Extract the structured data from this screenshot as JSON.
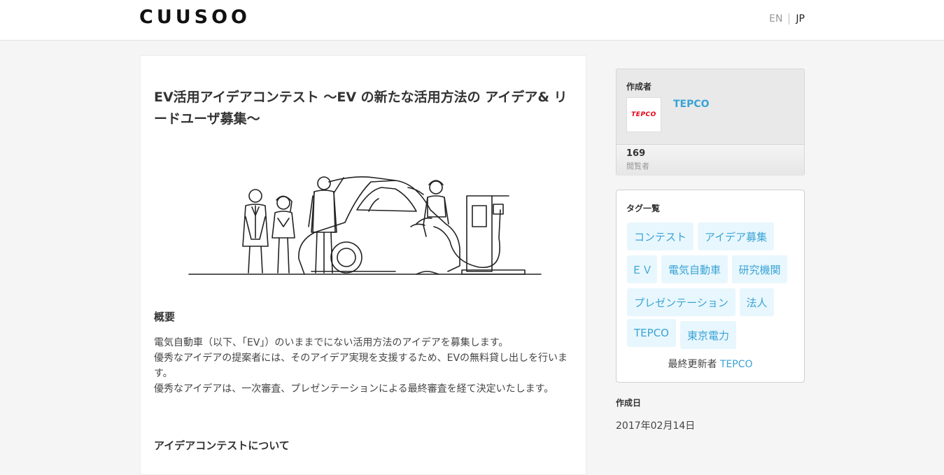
{
  "header": {
    "logo": "CUUSOO",
    "lang_en": "EN",
    "lang_jp": "JP"
  },
  "article": {
    "title": "EV活用アイデアコンテスト ～EV の新たな活用方法の アイデア& リードユーザ募集～",
    "overview_heading": "概要",
    "overview_lines": [
      "電気自動車（以下、「EV」）のいままでにない活用方法のアイデアを募集します。",
      "優秀なアイデアの提案者には、そのアイデア実現を支援するため、EVの無料貸し出しを行います。",
      "優秀なアイデアは、一次審査、プレゼンテーションによる最終審査を経て決定いたします。"
    ],
    "contest_heading": "アイデアコンテストについて"
  },
  "author": {
    "label": "作成者",
    "logo_text": "TEPCO",
    "name": "TEPCO",
    "views_count": "169",
    "views_label": "閲覧者"
  },
  "tags": {
    "label": "タグ一覧",
    "items": [
      "コンテスト",
      "アイデア募集",
      "ＥＶ",
      "電気自動車",
      "研究機関",
      "プレゼンテーション",
      "法人",
      "TEPCO",
      "東京電力"
    ],
    "updated_label": "最終更新者",
    "updated_by": "TEPCO"
  },
  "created": {
    "label": "作成日",
    "date": "2017年02月14日"
  },
  "colors": {
    "link": "#3aa3d6",
    "tag_bg": "#e8f7fd",
    "brand_red": "#e60012"
  }
}
